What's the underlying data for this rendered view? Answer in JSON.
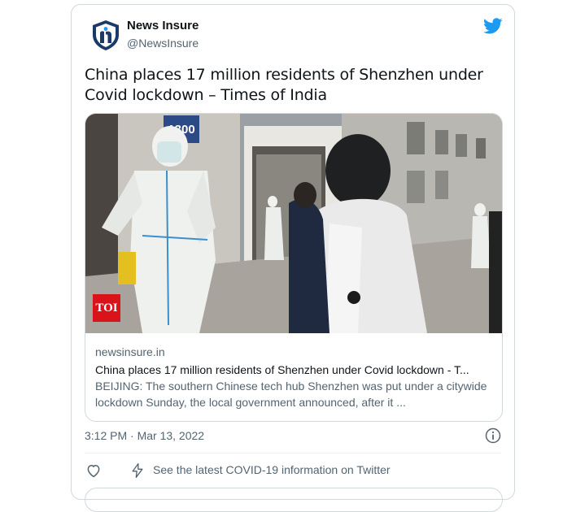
{
  "tweet": {
    "author_name": "News Insure",
    "author_handle": "@NewsInsure",
    "text": "China places 17 million residents of Shenzhen under Covid lockdown – Times of India",
    "timestamp": "3:12 PM · Mar 13, 2022",
    "covid_info_link": "See the latest COVID-19 information on Twitter"
  },
  "link_card": {
    "domain": "newsinsure.in",
    "title": "China places 17 million residents of Shenzhen under Covid lockdown - T...",
    "description": "BEIJING: The southern Chinese tech hub Shenzhen was put under a citywide lockdown Sunday, the local government announced, after it ...",
    "badge": "TOI",
    "door_number": "1300"
  },
  "colors": {
    "brand_blue": "#1d9bf0",
    "text_primary": "#0f1419",
    "text_secondary": "#536471",
    "border": "#cfd9de",
    "toi_red": "#d8141a"
  },
  "icons": {
    "brand": "twitter-bird-icon",
    "avatar": "news-insure-shield-logo",
    "info": "info-circle-icon",
    "like": "heart-icon",
    "covid": "lightning-bolt-icon"
  }
}
